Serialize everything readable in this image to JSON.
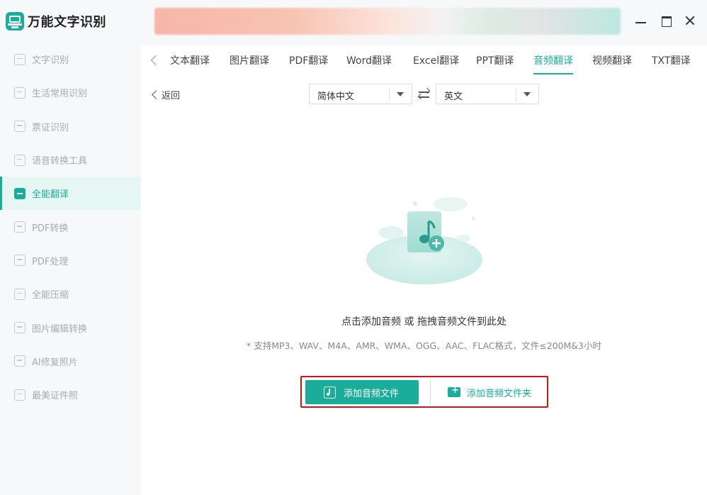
{
  "app": {
    "title": "万能文字识别"
  },
  "sidebar": {
    "items": [
      {
        "label": "文字识别",
        "icon": "text-scan-icon",
        "active": false
      },
      {
        "label": "生活常用识别",
        "icon": "life-scan-icon",
        "active": false
      },
      {
        "label": "票证识别",
        "icon": "ticket-scan-icon",
        "active": false
      },
      {
        "label": "语音转换工具",
        "icon": "voice-icon",
        "active": false
      },
      {
        "label": "全能翻译",
        "icon": "translate-icon",
        "active": true
      },
      {
        "label": "PDF转换",
        "icon": "pdf-convert-icon",
        "active": false
      },
      {
        "label": "PDF处理",
        "icon": "pdf-process-icon",
        "active": false
      },
      {
        "label": "全能压缩",
        "icon": "compress-icon",
        "active": false
      },
      {
        "label": "图片编辑转换",
        "icon": "image-edit-icon",
        "active": false
      },
      {
        "label": "AI修复照片",
        "icon": "ai-photo-icon",
        "active": false
      },
      {
        "label": "最美证件照",
        "icon": "id-photo-icon",
        "active": false
      }
    ]
  },
  "tabs": [
    {
      "label": "文本翻译",
      "active": false
    },
    {
      "label": "图片翻译",
      "active": false
    },
    {
      "label": "PDF翻译",
      "active": false
    },
    {
      "label": "Word翻译",
      "active": false
    },
    {
      "label": "Excel翻译",
      "active": false
    },
    {
      "label": "PPT翻译",
      "active": false
    },
    {
      "label": "音频翻译",
      "active": true
    },
    {
      "label": "视频翻译",
      "active": false
    },
    {
      "label": "TXT翻译",
      "active": false
    }
  ],
  "content": {
    "back_label": "返回",
    "source_lang": "简体中文",
    "target_lang": "英文",
    "drop_hint": "点击添加音频 或 拖拽音频文件到此处",
    "format_hint": "* 支持MP3、WAV、M4A、AMR、WMA、OGG、AAC、FLAC格式，文件≤200M&3小时",
    "add_file_label": "添加音频文件",
    "add_folder_label": "添加音频文件夹"
  },
  "colors": {
    "accent": "#1aad9a",
    "highlight_border": "#d0141a"
  }
}
